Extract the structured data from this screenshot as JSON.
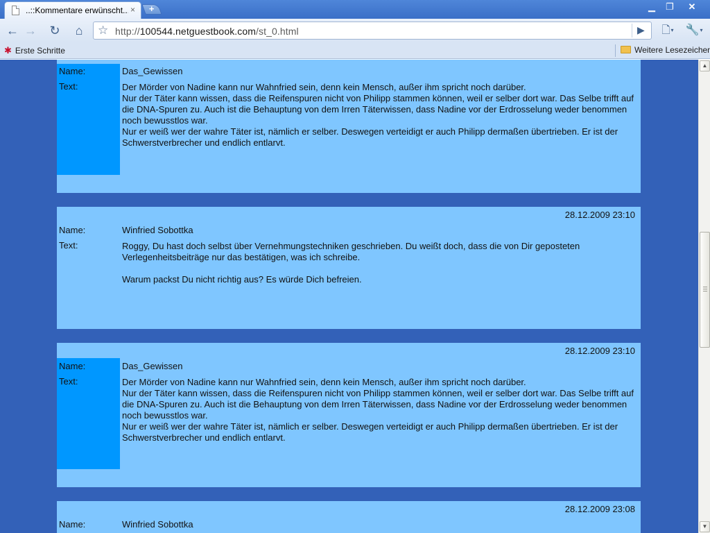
{
  "window": {
    "tab_title": "..::Kommentare erwünscht...",
    "tab_close": "×",
    "new_tab": "+",
    "min": "▁",
    "restore": "❐",
    "close": "✕"
  },
  "toolbar": {
    "back": "←",
    "forward": "→",
    "reload": "↻",
    "home": "⌂",
    "star": "☆",
    "url_prefix": "http://",
    "url_host": "100544.netguestbook.com",
    "url_path": "/st_0.html",
    "go": "▶",
    "page_menu": "🗋",
    "tools_menu": "🔧",
    "caret": "▾"
  },
  "bookmarks": {
    "first_steps": "Erste Schritte",
    "other": "Weitere Lesezeichen"
  },
  "labels": {
    "name": "Name:",
    "text": "Text:"
  },
  "entries": [
    {
      "date": "",
      "name": "Das_Gewissen",
      "text": [
        "Der Mörder von Nadine kann nur Wahnfried sein, denn kein Mensch, außer ihm spricht noch darüber.",
        "Nur der Täter kann wissen, dass die Reifenspuren nicht von Philipp stammen können, weil er selber dort war. Das Selbe trifft auf die DNA-Spuren zu. Auch ist die Behauptung von dem Irren Täterwissen, dass Nadine vor der Erdrosselung weder benommen noch bewusstlos war.",
        "Nur er weiß wer der wahre Täter ist, nämlich er selber. Deswegen verteidigt er auch Philipp dermaßen übertrieben. Er ist der Schwerstverbrecher und endlich entlarvt."
      ]
    },
    {
      "date": "28.12.2009 23:10",
      "name": "Winfried Sobottka",
      "text": [
        "Roggy, Du hast doch selbst über Vernehmungstechniken geschrieben. Du weißt doch, dass die von Dir geposteten Verlegenheitsbeiträge nur das bestätigen, was ich schreibe.",
        "",
        "Warum packst Du nicht richtig aus? Es würde Dich befreien."
      ]
    },
    {
      "date": "28.12.2009 23:10",
      "name": "Das_Gewissen",
      "text": [
        "Der Mörder von Nadine kann nur Wahnfried sein, denn kein Mensch, außer ihm spricht noch darüber.",
        "Nur der Täter kann wissen, dass die Reifenspuren nicht von Philipp stammen können, weil er selber dort war. Das Selbe trifft auf die DNA-Spuren zu. Auch ist die Behauptung von dem Irren Täterwissen, dass Nadine vor der Erdrosselung weder benommen noch bewusstlos war.",
        "Nur er weiß wer der wahre Täter ist, nämlich er selber. Deswegen verteidigt er auch Philipp dermaßen übertrieben. Er ist der Schwerstverbrecher und endlich entlarvt."
      ]
    },
    {
      "date": "28.12.2009 23:08",
      "name": "Winfried Sobottka",
      "text": []
    }
  ],
  "scrollbar": {
    "up": "▲",
    "down": "▼",
    "position": 0.48
  }
}
